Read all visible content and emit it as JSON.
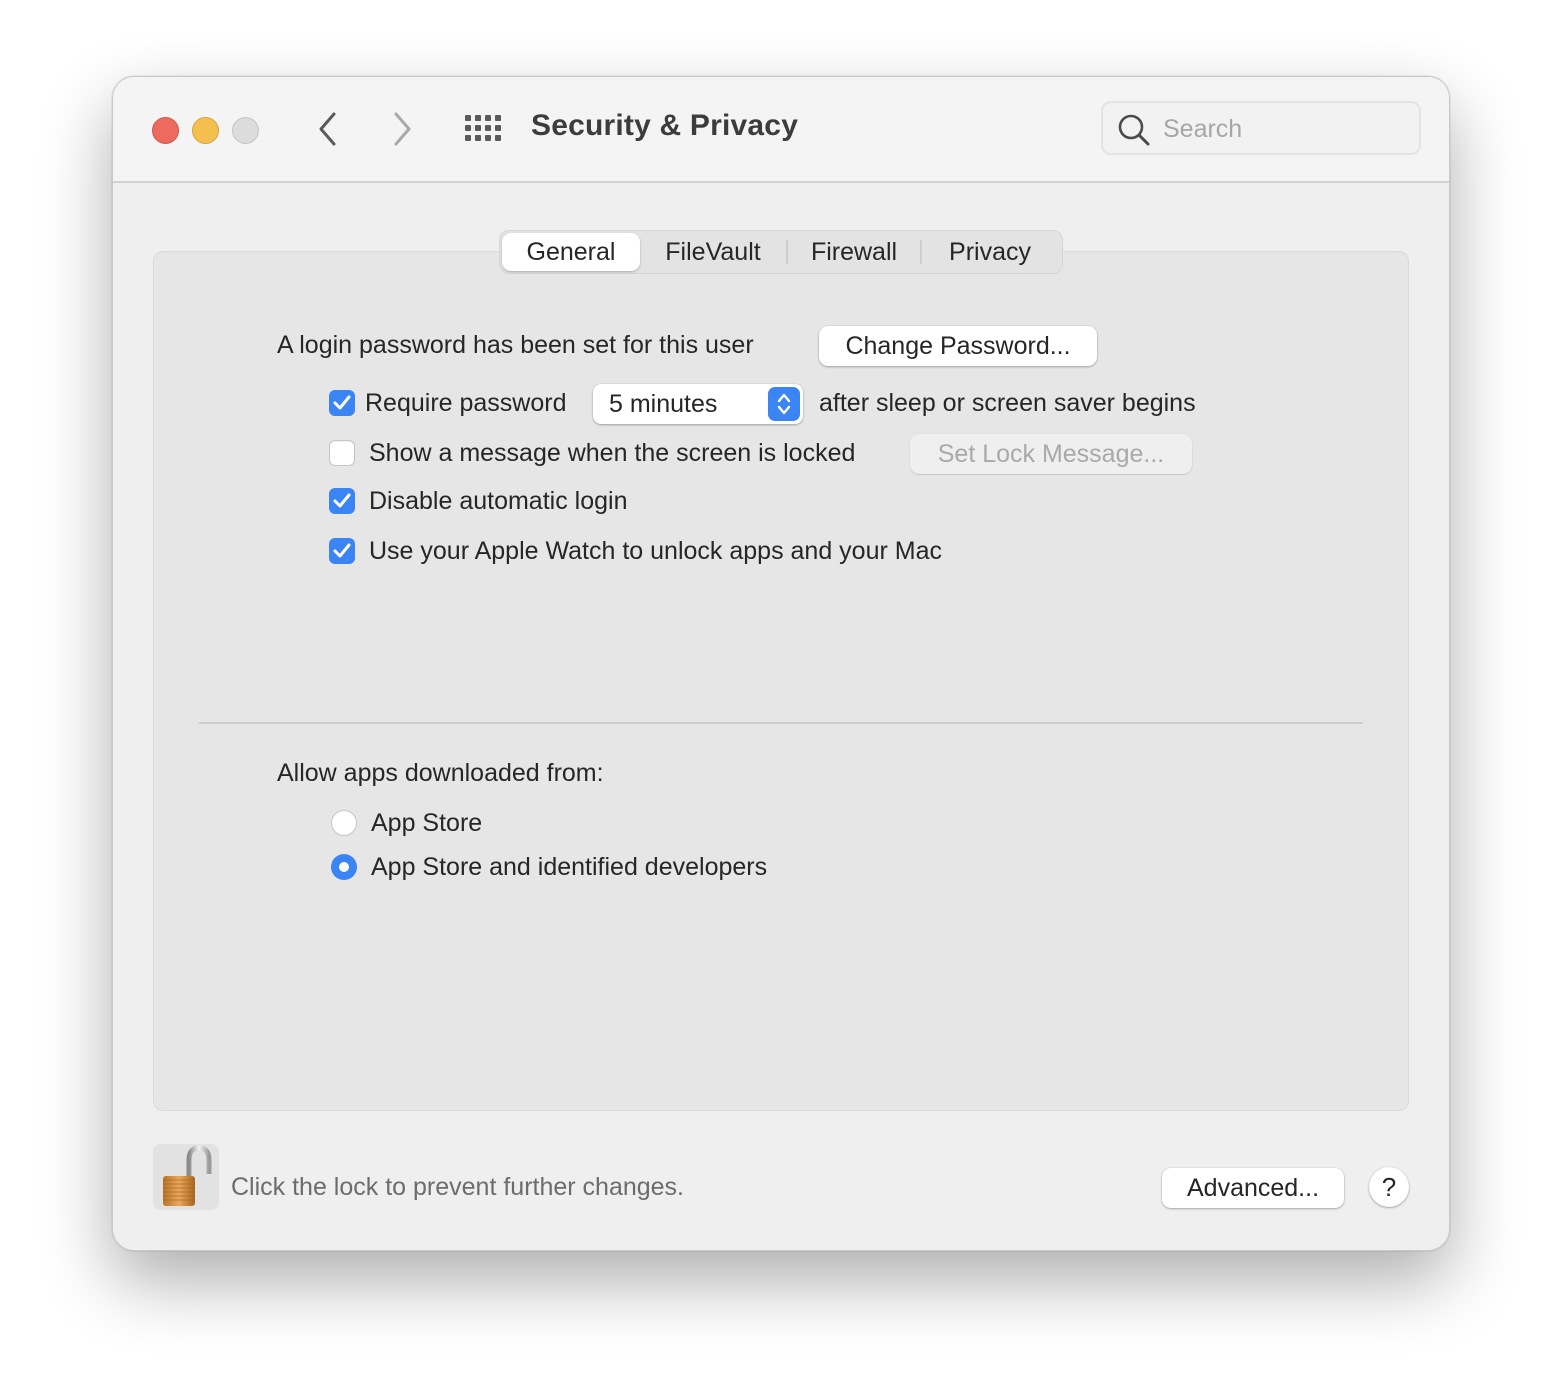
{
  "window": {
    "title": "Security & Privacy",
    "controls": {
      "close": "close-window",
      "minimize": "minimize-window",
      "zoom": "zoom-window"
    },
    "nav": {
      "back_icon": "chevron-left-icon",
      "forward_icon": "chevron-right-icon",
      "show_all_icon": "grid-icon"
    },
    "search": {
      "placeholder": "Search",
      "value": "",
      "icon": "search-icon"
    }
  },
  "tabs": [
    {
      "label": "General",
      "active": true
    },
    {
      "label": "FileVault",
      "active": false
    },
    {
      "label": "Firewall",
      "active": false
    },
    {
      "label": "Privacy",
      "active": false
    }
  ],
  "general": {
    "login_password_text": "A login password has been set for this user",
    "change_password_label": "Change Password...",
    "require_password": {
      "checked": true,
      "label": "Require password",
      "delay_value": "5 minutes",
      "suffix": "after sleep or screen saver begins"
    },
    "show_message": {
      "checked": false,
      "label": "Show a message when the screen is locked",
      "button_label": "Set Lock Message...",
      "button_enabled": false
    },
    "disable_auto_login": {
      "checked": true,
      "label": "Disable automatic login"
    },
    "apple_watch_unlock": {
      "checked": true,
      "label": "Use your Apple Watch to unlock apps and your Mac"
    },
    "allow_apps": {
      "heading": "Allow apps downloaded from:",
      "options": [
        {
          "label": "App Store",
          "selected": false
        },
        {
          "label": "App Store and identified developers",
          "selected": true
        }
      ]
    }
  },
  "footer": {
    "lock_state": "unlocked",
    "lock_text": "Click the lock to prevent further changes.",
    "advanced_label": "Advanced...",
    "help_label": "?"
  },
  "colors": {
    "accent": "#3b84f3",
    "close": "#ec6a5e",
    "minimize": "#f4bf4f",
    "zoom_inactive": "#dcdcdc"
  }
}
